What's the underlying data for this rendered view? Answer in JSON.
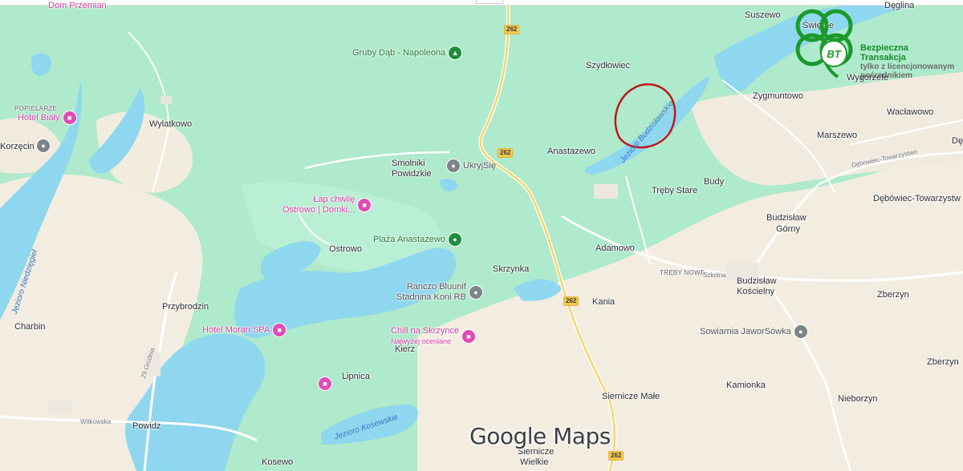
{
  "map": {
    "brand": "Google Maps",
    "badge": {
      "line1": "Bezpieczna",
      "line2": "Transakcja",
      "line3": "tylko z licencjonowanym",
      "line4": "pośrednikiem",
      "logo": "BT"
    },
    "places": {
      "dom_przemian": "Dom Przemian",
      "popielarze": "POPIELARZE",
      "korzecin": "Korzęcin",
      "wylatkowo": "Wylatkowo",
      "smolniki_1": "Smolniki",
      "smolniki_2": "Powidzkie",
      "ostrowo": "Ostrowo",
      "przybrodzin": "Przybrodzin",
      "charbin": "Charbin",
      "skrzynka": "Skrzynka",
      "kierz": "Kierz",
      "lipnica": "Lipnica",
      "witkowska": "Witkowska",
      "powidz": "Powidz",
      "kosewo": "Kosewo",
      "gruden": "29 Grudnia",
      "suszewo": "Suszewo",
      "szydlowiec": "Szydłowiec",
      "swietne": "Świętne",
      "deglino": "Dęglina",
      "wygorzele": "Wygorzele",
      "zygmuntowo": "Zygmuntowo",
      "waclawowo": "Wacławowo",
      "marszewo": "Marszewo",
      "debowiec_road": "Dębowiec-Towarzystwo",
      "debowiec": "Dębówiec-Towarzystw",
      "de": "Dę",
      "anastazewo": "Anastazewo",
      "treby_stare": "Trębу Stare",
      "budy": "Budy",
      "budzislaw_gorny_1": "Budzisław",
      "budzislaw_gorny_2": "Górny",
      "adamowo": "Adamowo",
      "treby_nowe": "TRĘBY NOWE",
      "szkolna": "Szkolna",
      "budzislaw_k_1": "Budzisław",
      "budzislaw_k_2": "Kościelny",
      "zberzyn": "Zberzyn",
      "zberzyn2": "Zberzyn",
      "kania": "Kania",
      "kamionka": "Kamionka",
      "nieborzyn": "Nieborzyn",
      "siernicze_male": "Siernicze Małe",
      "siernicze_w_1": "Siernicze",
      "siernicze_w_2": "Wielkie"
    },
    "lakes": {
      "niedzieg": "Jezioro Niedzięgiel",
      "budzislawskie": "Jezioro Budzisławskie",
      "kosewskie": "Jezioro Kosewskie"
    },
    "pois": [
      {
        "key": "hotel_bialy",
        "label": "Hotel Biały",
        "kind": "hotel"
      },
      {
        "key": "gruby_dab",
        "label": "Gruby Dąb - Napoleona",
        "kind": "park"
      },
      {
        "key": "ukryjsie",
        "label": "UkryjSię",
        "kind": "place"
      },
      {
        "key": "lap_chwile",
        "label": "Łap chwilę",
        "label2": "Ostrowo | Domki...",
        "kind": "hotel"
      },
      {
        "key": "plaza",
        "label": "Plaża Anastazewo",
        "kind": "park"
      },
      {
        "key": "ranczo",
        "label": "Ranczo Bluunif",
        "label2": "Stadnina Koni RB",
        "kind": "place"
      },
      {
        "key": "moran",
        "label": "Hotel Moran SPA",
        "kind": "hotel"
      },
      {
        "key": "chill",
        "label": "Chill na Skrzynce",
        "sub": "Najwyżej oceniane",
        "kind": "hotel"
      },
      {
        "key": "lipnica_pin",
        "label": "",
        "kind": "hotel"
      },
      {
        "key": "sowiarnia",
        "label": "Sowiarnia JaworSówka",
        "kind": "place"
      }
    ],
    "roads": {
      "r1": "262",
      "r2": "262",
      "r3": "262",
      "r4": "262"
    },
    "icons": {
      "hotel": "bed-icon",
      "park": "tree-icon",
      "place": "pin-icon"
    },
    "colors": {
      "land": "#aeeacb",
      "farmland": "#f3ede1",
      "water": "#8fd7ee",
      "annotation": "#c0151f"
    }
  }
}
